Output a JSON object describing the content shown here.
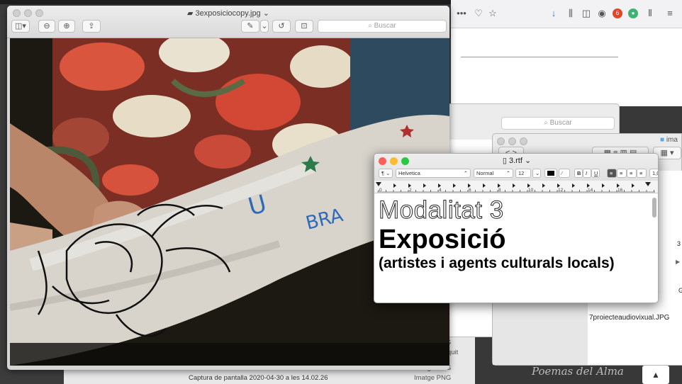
{
  "browser": {
    "poemas_text": "Poemas del Alma",
    "badge_count": "6"
  },
  "finder_bottom": {
    "rows": [
      {
        "name": "",
        "kind": "Imatge PNG"
      },
      {
        "name": "",
        "kind": "docum...nriquit"
      },
      {
        "name": "",
        "kind": "Imatge PNG"
      },
      {
        "name": "Captura de pantalla 2020-04-30 a les 14.02.26",
        "kind": "Imatge PNG"
      }
    ]
  },
  "finder1": {
    "search_placeholder": "Buscar"
  },
  "finder2": {
    "title": "ima",
    "file_name": "7proiecteaudiovixual.JPG",
    "partial_1": "3",
    "partial_2": "G"
  },
  "preview": {
    "title": "3exposiciocopy.jpg",
    "search_placeholder": "Buscar",
    "photo_alt": "Foto"
  },
  "textedit": {
    "title": "3.rtf",
    "paragraph_style": "¶",
    "font_family": "Helvetica",
    "font_style": "Normal",
    "font_size": "12",
    "bold": "B",
    "italic": "I",
    "underline": "U",
    "spacing": "1,0",
    "ruler_numbers": [
      "0",
      "2",
      "4",
      "6",
      "8",
      "10",
      "12",
      "14",
      "16"
    ],
    "line1": "Modalitat 3",
    "line2": "Exposició",
    "line3": "(artistes i agents culturals locals)"
  }
}
